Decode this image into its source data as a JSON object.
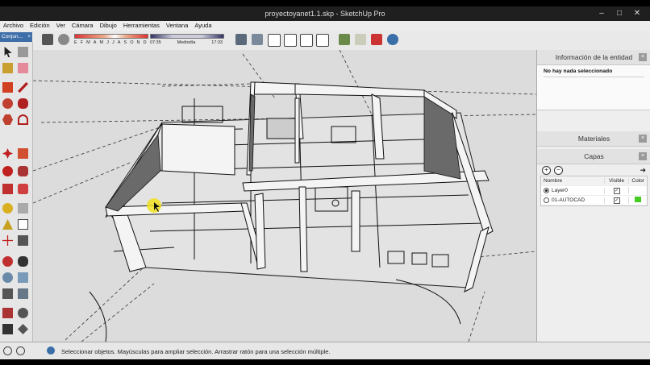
{
  "window": {
    "title": "proyectoyanet1.1.skp - SketchUp Pro"
  },
  "menu": [
    "Archivo",
    "Edición",
    "Ver",
    "Cámara",
    "Dibujo",
    "Herramientas",
    "Ventana",
    "Ayuda"
  ],
  "tray_tab": {
    "label": "Conjun...",
    "close": "×"
  },
  "shadow_strip": {
    "months": [
      "E",
      "F",
      "M",
      "A",
      "M",
      "J",
      "J",
      "A",
      "S",
      "O",
      "N",
      "D"
    ],
    "time_start": "07:35",
    "time_mid": "Mediodía",
    "time_end": "17:33"
  },
  "panels": {
    "entity_info": {
      "title": "Información de la entidad",
      "message": "No hay nada seleccionado"
    },
    "materials": {
      "title": "Materiales"
    },
    "layers": {
      "title": "Capas",
      "columns": {
        "name": "Nombre",
        "visible": "Visible",
        "color": "Color"
      },
      "rows": [
        {
          "name": "Layer0",
          "active": true,
          "visible": true,
          "color": "#ffffff"
        },
        {
          "name": "01-AUTOCAD",
          "active": false,
          "visible": true,
          "color": "#44cc22"
        }
      ]
    }
  },
  "status": {
    "message": "Seleccionar objetos. Mayúsculas para ampliar selección. Arrastrar ratón para una selección múltiple."
  },
  "colors": {
    "accent": "#3d6ea8",
    "viewport_bg": "#dcdcdc",
    "model_wall": "#f2f2f2",
    "model_shadow": "#555555",
    "cursor_highlight": "#f0e020"
  }
}
